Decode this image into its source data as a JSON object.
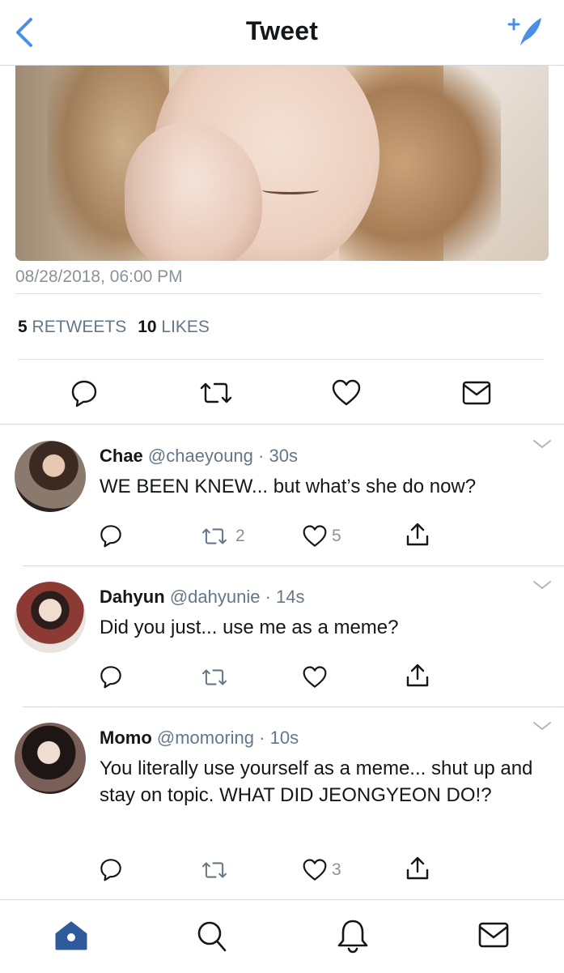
{
  "header": {
    "title": "Tweet",
    "back_icon": "chevron-left-icon",
    "compose_icon": "compose-feather-icon"
  },
  "tweet": {
    "timestamp": "08/28/2018, 06:00 PM",
    "retweets_count": "5",
    "retweets_label": "RETWEETS",
    "likes_count": "10",
    "likes_label": "LIKES"
  },
  "replies": [
    {
      "name": "Chae",
      "handle": "@chaeyoung",
      "separator": "·",
      "time": "30s",
      "text": "WE BEEN KNEW... but what’s she do now?",
      "retweets": "2",
      "likes": "5"
    },
    {
      "name": "Dahyun",
      "handle": "@dahyunie",
      "separator": "·",
      "time": "14s",
      "text": "Did you just... use me as a meme?",
      "retweets": "",
      "likes": ""
    },
    {
      "name": "Momo",
      "handle": "@momoring",
      "separator": "·",
      "time": "10s",
      "text": "You literally use yourself as a meme... shut up and stay on topic. WHAT DID JEONGYEON DO!?",
      "retweets": "",
      "likes": "3"
    }
  ],
  "tabbar": [
    "home-icon",
    "search-icon",
    "notifications-bell-icon",
    "messages-envelope-icon"
  ],
  "colors": {
    "accent": "#1da1f2",
    "icon_dark": "#14171a",
    "muted": "#657786",
    "home_active": "#2f5a9c"
  }
}
